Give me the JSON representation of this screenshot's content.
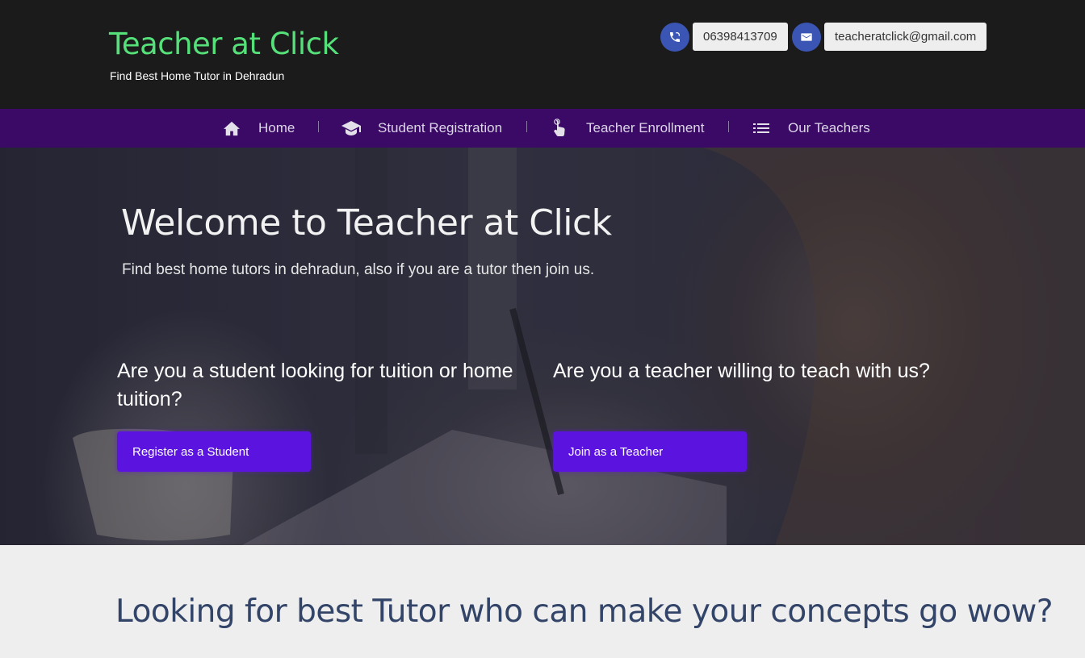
{
  "header": {
    "title": "Teacher at Click",
    "subtitle": "Find Best Home Tutor in Dehradun",
    "phone": {
      "icon": "phone-icon",
      "value": "06398413709"
    },
    "email": {
      "icon": "mail-icon",
      "value": "teacheratclick@gmail.com"
    }
  },
  "nav": {
    "items": [
      {
        "label": "Home",
        "icon": "home-icon"
      },
      {
        "label": "Student Registration",
        "icon": "graduation-cap-icon"
      },
      {
        "label": "Teacher Enrollment",
        "icon": "hand-pointer-icon"
      },
      {
        "label": "Our Teachers",
        "icon": "list-icon"
      }
    ]
  },
  "hero": {
    "title": "Welcome to Teacher at Click",
    "lead": "Find best home tutors in dehradun, also if you are a tutor then join us.",
    "student": {
      "question": "Are you a student looking for tuition or home tuition?",
      "button": "Register as a Student"
    },
    "teacher": {
      "question": "Are you a teacher willing to teach with us?",
      "button": "Join as a Teacher"
    }
  },
  "section": {
    "title": "Looking for best Tutor who can make your concepts go wow?"
  },
  "colors": {
    "brand_green": "#56e07a",
    "nav_purple": "#3a0a66",
    "button_purple": "#5b14e0",
    "icon_blue": "#3a55b3",
    "section_text": "#324468"
  }
}
